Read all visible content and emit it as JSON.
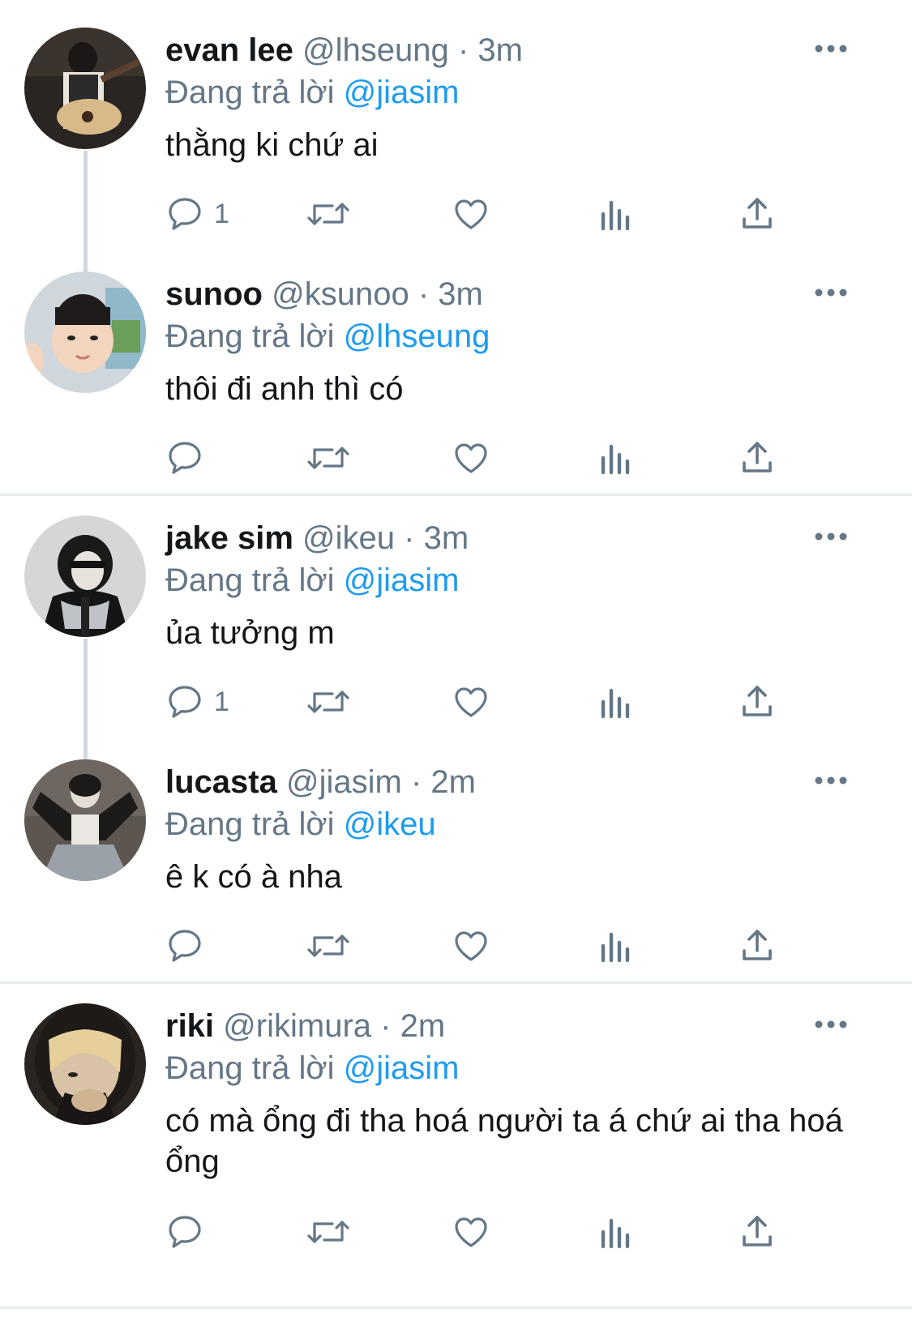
{
  "colors": {
    "text": "#14171a",
    "muted": "#657786",
    "mention": "#1d9bf0",
    "thread_line": "#cfd9de",
    "divider": "#e6ecf0"
  },
  "tweets": [
    {
      "name": "evan lee",
      "handle": "@lhseung",
      "sep": "·",
      "time": "3m",
      "replying_prefix": "Đang trả lời",
      "replying_to": "@jiasim",
      "text": "thằng ki chứ ai",
      "reply_count": "1"
    },
    {
      "name": "sunoo",
      "handle": "@ksunoo",
      "sep": "·",
      "time": "3m",
      "replying_prefix": "Đang trả lời",
      "replying_to": "@lhseung",
      "text": "thôi đi anh thì có",
      "reply_count": ""
    },
    {
      "name": "jake sim",
      "handle": "@ikeu",
      "sep": "·",
      "time": "3m",
      "replying_prefix": "Đang trả lời",
      "replying_to": "@jiasim",
      "text": "ủa tưởng m",
      "reply_count": "1"
    },
    {
      "name": "lucasta",
      "handle": "@jiasim",
      "sep": "·",
      "time": "2m",
      "replying_prefix": "Đang trả lời",
      "replying_to": "@ikeu",
      "text": "ê k có à nha",
      "reply_count": ""
    },
    {
      "name": "riki",
      "handle": "@rikimura",
      "sep": "·",
      "time": "2m",
      "replying_prefix": "Đang trả lời",
      "replying_to": "@jiasim",
      "text": "có mà ổng đi tha hoá người ta á chứ ai tha hoá ổng",
      "reply_count": ""
    }
  ]
}
